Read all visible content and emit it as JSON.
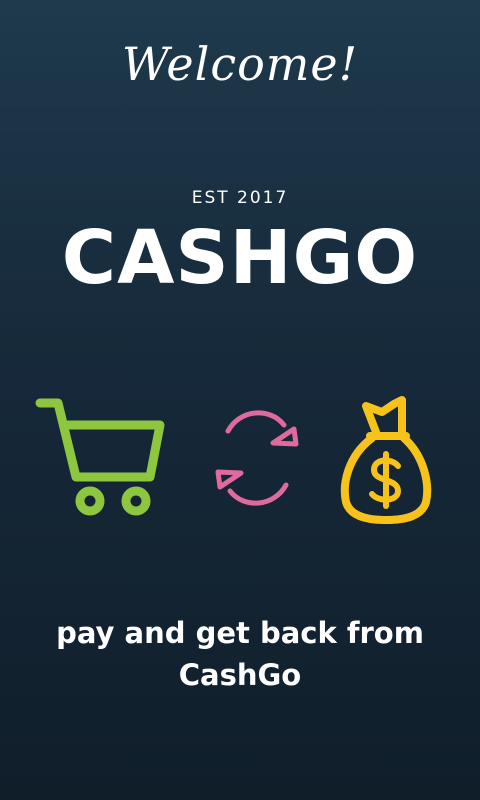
{
  "screen": {
    "welcome": "Welcome!",
    "established": "EST 2017",
    "brand": "CASHGO",
    "tagline": "pay and get back from CashGo"
  },
  "icons": [
    {
      "name": "shopping-cart-icon",
      "color": "#8dc63f"
    },
    {
      "name": "refresh-icon",
      "color": "#e06a9d"
    },
    {
      "name": "money-bag-icon",
      "color": "#f7c21a"
    }
  ],
  "colors": {
    "background_top": "#1e3a4c",
    "background_bottom": "#101e2a",
    "text": "#ffffff"
  }
}
